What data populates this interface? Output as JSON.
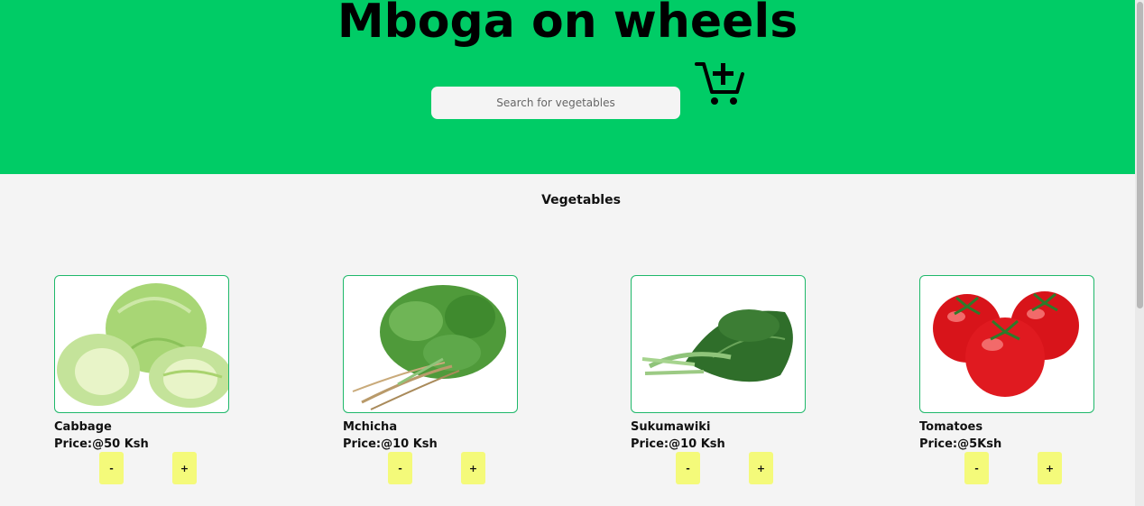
{
  "header": {
    "title": "Mboga on wheels",
    "search_placeholder": "Search for vegetables",
    "cart_icon": "add-to-cart-icon",
    "background": "#00cc66"
  },
  "section": {
    "title": "Vegetables"
  },
  "products": [
    {
      "name": "Cabbage",
      "price": "Price:@50 Ksh",
      "minus": "-",
      "plus": "+"
    },
    {
      "name": "Mchicha",
      "price": "Price:@10 Ksh",
      "minus": "-",
      "plus": "+"
    },
    {
      "name": "Sukumawiki",
      "price": "Price:@10 Ksh",
      "minus": "-",
      "plus": "+"
    },
    {
      "name": "Tomatoes",
      "price": "Price:@5Ksh",
      "minus": "-",
      "plus": "+"
    }
  ],
  "colors": {
    "accent": "#00cc66",
    "button": "#f4fa7a",
    "card_border": "#1fb86a"
  }
}
